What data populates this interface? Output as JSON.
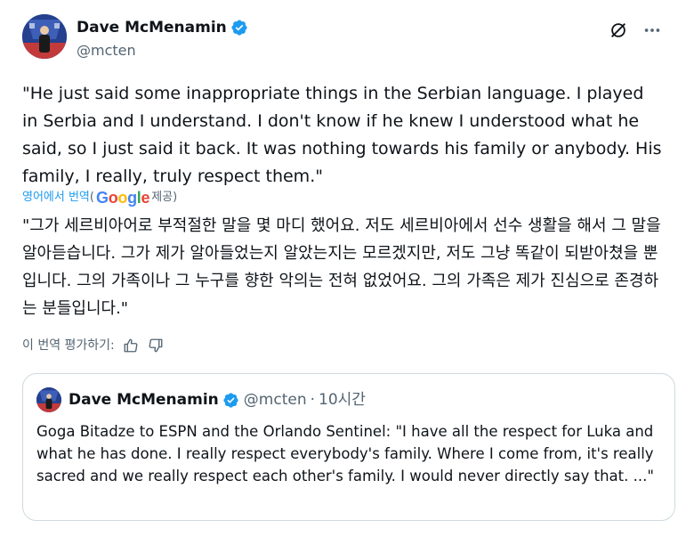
{
  "author": {
    "name": "Dave McMenamin",
    "handle": "@mcten"
  },
  "tweet": {
    "text": "\"He just said some inappropriate things in the Serbian language. I played in Serbia and I understand. I don't know if he knew I understood what he said, so I just said it back. It was nothing towards his family or anybody. His family, I really, truly respect them.\""
  },
  "translation": {
    "link_label": "영어에서 번역",
    "paren_open": "(",
    "google_letters": [
      "G",
      "o",
      "o",
      "g",
      "l",
      "e"
    ],
    "provided_label": "제공)",
    "text": "\"그가 세르비아어로 부적절한 말을 몇 마디 했어요. 저도 세르비아에서 선수 생활을 해서 그 말을 알아듣습니다. 그가 제가 알아들었는지 알았는지는 모르겠지만, 저도 그냥 똑같이 되받아쳤을 뿐입니다. 그의 가족이나 그 누구를 향한 악의는 전혀 없었어요. 그의 가족은 제가 진심으로 존경하는 분들입니다.\"",
    "rate_label": "이 번역 평가하기:"
  },
  "quote": {
    "name": "Dave McMenamin",
    "handle": "@mcten",
    "separator": "·",
    "time": "10시간",
    "text": "Goga Bitadze to ESPN and the Orlando Sentinel: \"I have all the respect for Luka and what he has done. I really respect everybody's family. Where I come from, it's really sacred and we really respect each other's family. I would never directly say that. ...\""
  },
  "icons": {
    "verified": "verified-badge-icon",
    "no_view": "slashed-circle-icon",
    "more": "more-horizontal-icon",
    "thumbs_up": "thumbs-up-icon",
    "thumbs_down": "thumbs-down-icon"
  },
  "colors": {
    "accent": "#1d9bf0",
    "text": "#0f1419",
    "muted": "#536471",
    "border": "#cfd9de"
  }
}
